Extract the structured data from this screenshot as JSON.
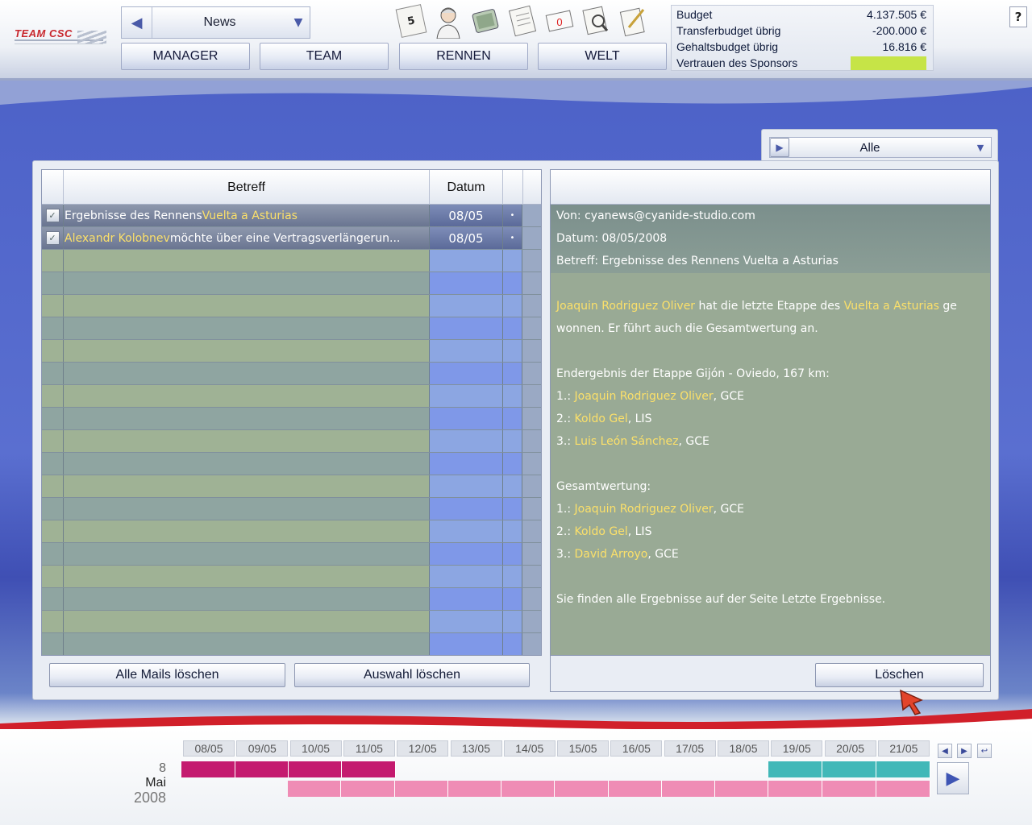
{
  "header": {
    "logo": "TEAM CSC",
    "nav_select_value": "News",
    "tabs": [
      "MANAGER",
      "TEAM",
      "RENNEN",
      "WELT"
    ],
    "icons": [
      {
        "name": "calendar-icon",
        "glyph": "5"
      },
      {
        "name": "rider-icon",
        "glyph": "🚴"
      },
      {
        "name": "money-icon",
        "glyph": "💵"
      },
      {
        "name": "contract-icon",
        "glyph": "📄"
      },
      {
        "name": "mail-icon",
        "glyph": "0"
      },
      {
        "name": "search-icon",
        "glyph": "🔍"
      },
      {
        "name": "notes-icon",
        "glyph": "📝"
      }
    ],
    "finance": [
      {
        "label": "Budget",
        "value": "4.137.505 €"
      },
      {
        "label": "Transferbudget übrig",
        "value": "-200.000 €"
      },
      {
        "label": "Gehaltsbudget übrig",
        "value": "16.816 €"
      },
      {
        "label": "Vertrauen des Sponsors",
        "value": ""
      }
    ],
    "sponsor_trust_color": "#c6e447",
    "help_label": "?"
  },
  "filter": {
    "value": "Alle"
  },
  "mail_list": {
    "col_subject": "Betreff",
    "col_date": "Datum",
    "rows": [
      {
        "subject_prefix": "Ergebnisse des Rennens ",
        "subject_highlight": "Vuelta a Asturias",
        "subject_suffix": "",
        "date": "08/05",
        "dot": "•"
      },
      {
        "subject_prefix": "",
        "subject_highlight": "Alexandr Kolobnev",
        "subject_suffix": " möchte über eine Vertragsverlängerun...",
        "date": "08/05",
        "dot": "•"
      }
    ],
    "delete_all_label": "Alle Mails löschen",
    "delete_selected_label": "Auswahl löschen"
  },
  "reader": {
    "from": "Von: cyanews@cyanide-studio.com",
    "date": "Datum: 08/05/2008",
    "subject": "Betreff: Ergebnisse des Rennens Vuelta a Asturias",
    "intro": {
      "winner": "Joaquin Rodriguez Oliver",
      "t1": " hat die letzte Etappe des ",
      "race": "Vuelta a Asturias",
      "t2": " ge",
      "t3": "wonnen. Er führt auch die Gesamtwertung an."
    },
    "stage_title": "Endergebnis der Etappe Gijón - Oviedo, 167 km:",
    "stage": [
      {
        "pos": "1.: ",
        "name": "Joaquin Rodriguez Oliver",
        "team": ", GCE"
      },
      {
        "pos": "2.: ",
        "name": "Koldo Gel",
        "team": ", LIS"
      },
      {
        "pos": "3.: ",
        "name": "Luis León Sánchez",
        "team": ", GCE"
      }
    ],
    "gc_title": "Gesamtwertung:",
    "gc": [
      {
        "pos": "1.: ",
        "name": "Joaquin Rodriguez Oliver",
        "team": ", GCE"
      },
      {
        "pos": "2.: ",
        "name": "Koldo Gel",
        "team": ", LIS"
      },
      {
        "pos": "3.: ",
        "name": "David Arroyo",
        "team": ", GCE"
      }
    ],
    "footer_note": "Sie finden alle Ergebnisse auf der Seite Letzte Ergebnisse.",
    "delete_label": "Löschen"
  },
  "calendar": {
    "day": "8",
    "month": "Mai",
    "year": "2008",
    "days": [
      "08/05",
      "09/05",
      "10/05",
      "11/05",
      "12/05",
      "13/05",
      "14/05",
      "15/05",
      "16/05",
      "17/05",
      "18/05",
      "19/05",
      "20/05",
      "21/05"
    ]
  }
}
